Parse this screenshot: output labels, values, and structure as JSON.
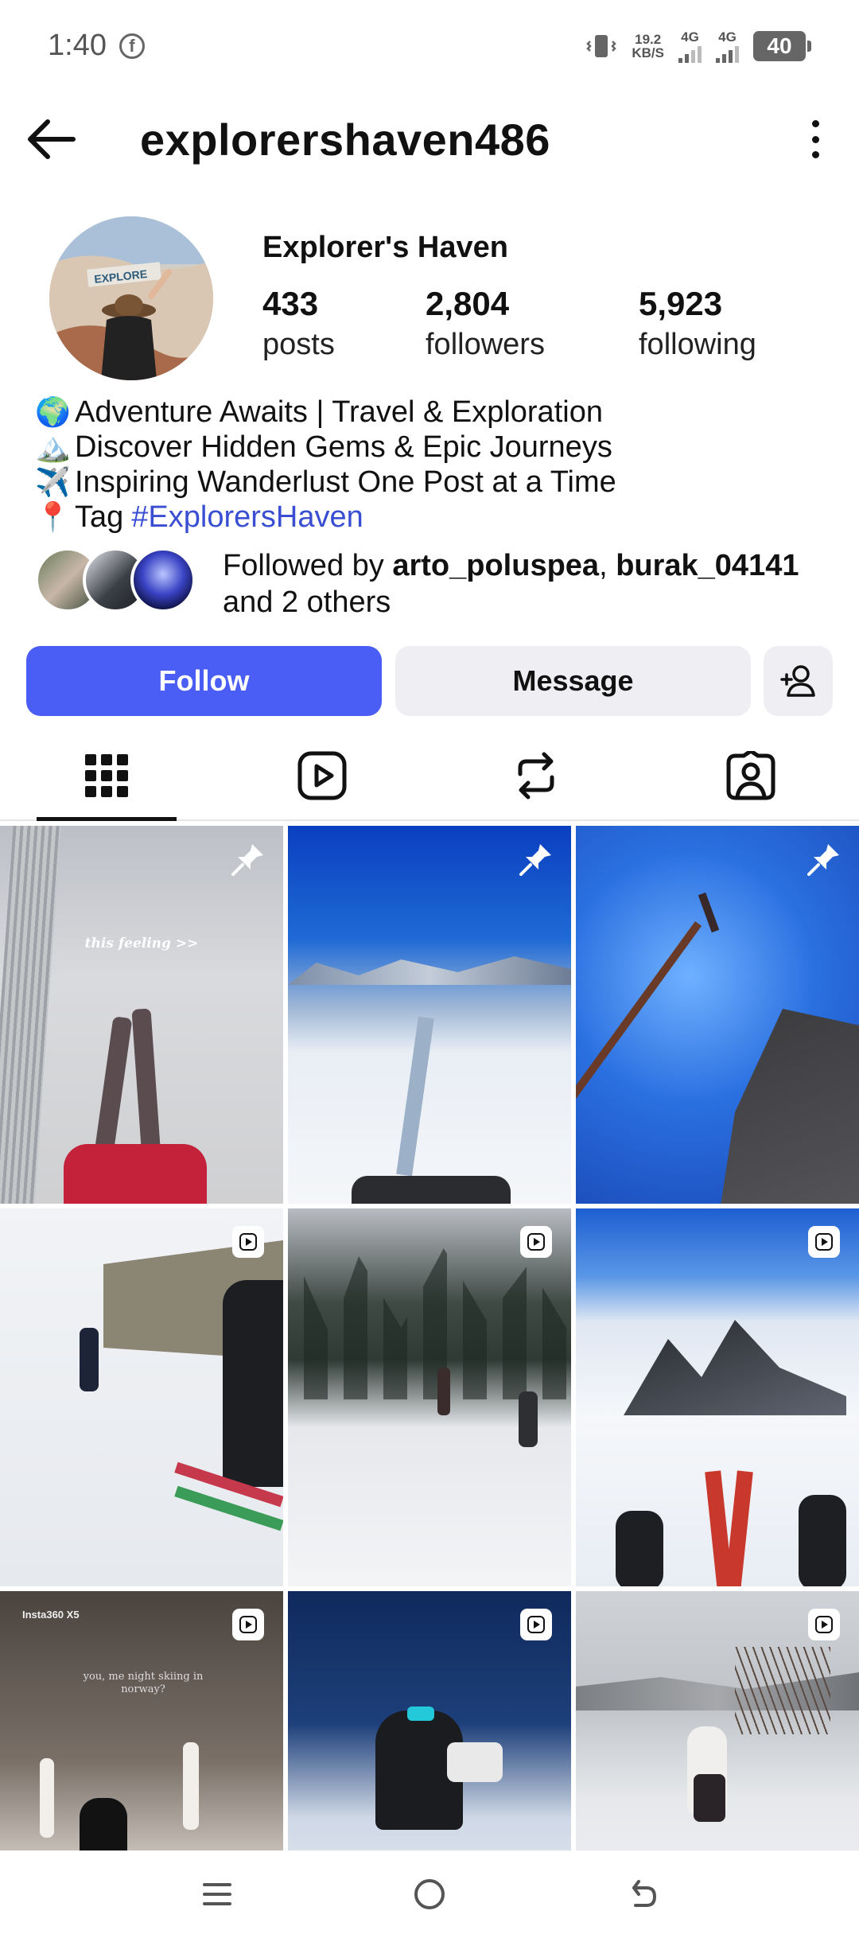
{
  "status_bar": {
    "time": "1:40",
    "net_speed_value": "19.2",
    "net_speed_unit": "KB/S",
    "sim1": "4G",
    "sim2": "4G",
    "battery": "40"
  },
  "header": {
    "username": "explorershaven486"
  },
  "profile": {
    "display_name": "Explorer's Haven",
    "posts_count": "433",
    "posts_label": "posts",
    "followers_count": "2,804",
    "followers_label": "followers",
    "following_count": "5,923",
    "following_label": "following",
    "avatar_sign_text": "EXPLORE"
  },
  "bio": [
    {
      "emoji": "🌍",
      "text": "Adventure Awaits | Travel & Exploration"
    },
    {
      "emoji": "🏔️",
      "text": "Discover Hidden Gems & Epic Journeys"
    },
    {
      "emoji": "✈️",
      "text": "Inspiring Wanderlust One Post at a Time"
    },
    {
      "emoji": "📍",
      "text": "Tag",
      "hashtag": "#ExplorersHaven"
    }
  ],
  "followed_by": {
    "prefix": "Followed by",
    "user1": "arto_poluspea",
    "separator": ",",
    "user2": "burak_04141",
    "suffix": "and 2 others"
  },
  "actions": {
    "follow_label": "Follow",
    "message_label": "Message"
  },
  "colors": {
    "accent": "#4a5df5",
    "hashtag": "#3a4ed3",
    "button_bg": "#efeff3"
  },
  "tabs": [
    {
      "name": "grid-icon",
      "active": true
    },
    {
      "name": "reels-icon",
      "active": false
    },
    {
      "name": "reposts-icon",
      "active": false
    },
    {
      "name": "tagged-icon",
      "active": false
    }
  ],
  "posts": [
    {
      "type": "pinned",
      "caption": "this feeling >>"
    },
    {
      "type": "pinned"
    },
    {
      "type": "pinned"
    },
    {
      "type": "reel"
    },
    {
      "type": "reel"
    },
    {
      "type": "reel"
    },
    {
      "type": "reel",
      "brand": "Insta360 X5",
      "caption": "you, me night skiing in norway?"
    },
    {
      "type": "reel"
    },
    {
      "type": "reel"
    }
  ]
}
